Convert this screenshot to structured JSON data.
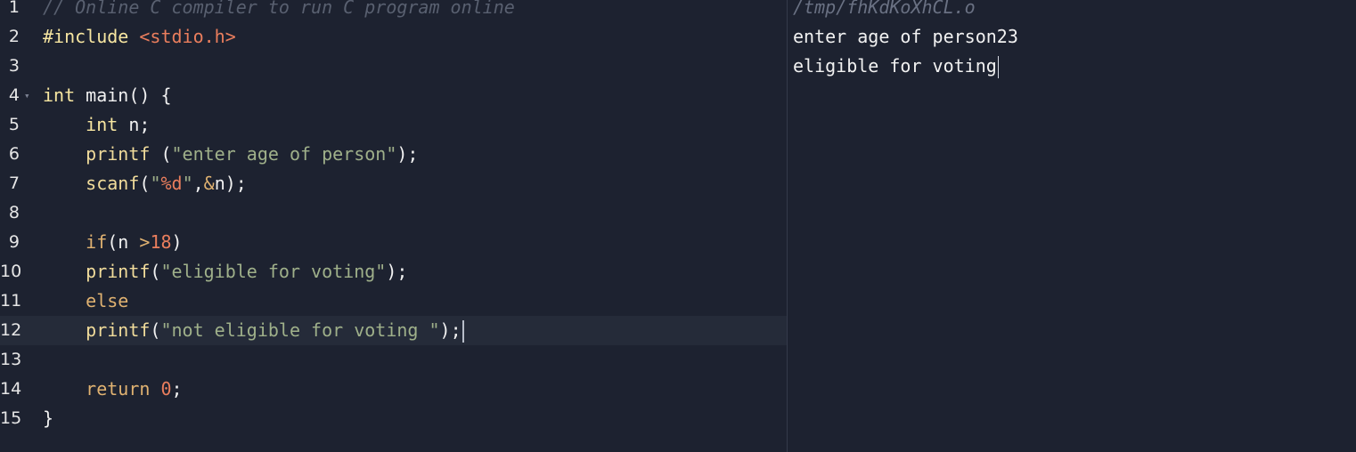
{
  "editor": {
    "lines": [
      {
        "num": "1",
        "tokens": [
          [
            "cmt",
            "// Online C compiler to run C program online"
          ]
        ]
      },
      {
        "num": "2",
        "tokens": [
          [
            "kw-type",
            "#include "
          ],
          [
            "inc",
            "<stdio.h>"
          ]
        ]
      },
      {
        "num": "3",
        "tokens": []
      },
      {
        "num": "4",
        "tokens": [
          [
            "kw-type",
            "int"
          ],
          [
            "kw-plain",
            " main() {"
          ]
        ],
        "fold": true
      },
      {
        "num": "5",
        "tokens": [
          [
            "kw-plain",
            "    "
          ],
          [
            "kw-type",
            "int"
          ],
          [
            "kw-plain",
            " n;"
          ]
        ]
      },
      {
        "num": "6",
        "tokens": [
          [
            "kw-plain",
            "    "
          ],
          [
            "kw-func",
            "printf"
          ],
          [
            "kw-plain",
            " ("
          ],
          [
            "str",
            "\"enter age of person\""
          ],
          [
            "kw-plain",
            ");"
          ]
        ]
      },
      {
        "num": "7",
        "tokens": [
          [
            "kw-plain",
            "    "
          ],
          [
            "kw-func",
            "scanf"
          ],
          [
            "kw-plain",
            "("
          ],
          [
            "str",
            "\""
          ],
          [
            "num",
            "%d"
          ],
          [
            "str",
            "\""
          ],
          [
            "kw-plain",
            ","
          ],
          [
            "kw-ctrl",
            "&"
          ],
          [
            "kw-plain",
            "n);"
          ]
        ]
      },
      {
        "num": "8",
        "tokens": []
      },
      {
        "num": "9",
        "tokens": [
          [
            "kw-plain",
            "    "
          ],
          [
            "kw-ctrl",
            "if"
          ],
          [
            "kw-plain",
            "(n "
          ],
          [
            "kw-ctrl",
            ">"
          ],
          [
            "num",
            "18"
          ],
          [
            "kw-plain",
            ")"
          ]
        ]
      },
      {
        "num": "10",
        "tokens": [
          [
            "kw-plain",
            "    "
          ],
          [
            "kw-func",
            "printf"
          ],
          [
            "kw-plain",
            "("
          ],
          [
            "str",
            "\"eligible for voting\""
          ],
          [
            "kw-plain",
            ");"
          ]
        ]
      },
      {
        "num": "11",
        "tokens": [
          [
            "kw-plain",
            "    "
          ],
          [
            "kw-ctrl",
            "else"
          ]
        ]
      },
      {
        "num": "12",
        "tokens": [
          [
            "kw-plain",
            "    "
          ],
          [
            "kw-func",
            "printf"
          ],
          [
            "kw-plain",
            "("
          ],
          [
            "str",
            "\"not eligible for voting \""
          ],
          [
            "kw-plain",
            ");"
          ]
        ],
        "active": true
      },
      {
        "num": "13",
        "tokens": []
      },
      {
        "num": "14",
        "tokens": [
          [
            "kw-plain",
            "    "
          ],
          [
            "kw-ctrl",
            "return"
          ],
          [
            "kw-plain",
            " "
          ],
          [
            "num",
            "0"
          ],
          [
            "kw-plain",
            ";"
          ]
        ]
      },
      {
        "num": "15",
        "tokens": [
          [
            "kw-plain",
            "}"
          ]
        ]
      }
    ]
  },
  "output": {
    "path": "/tmp/fhKdKoXhCL.o",
    "lines": [
      "enter age of person23",
      "eligible for voting"
    ]
  },
  "colors": {
    "background": "#1d2230",
    "active_line": "#252b39",
    "divider": "#343a4a"
  }
}
